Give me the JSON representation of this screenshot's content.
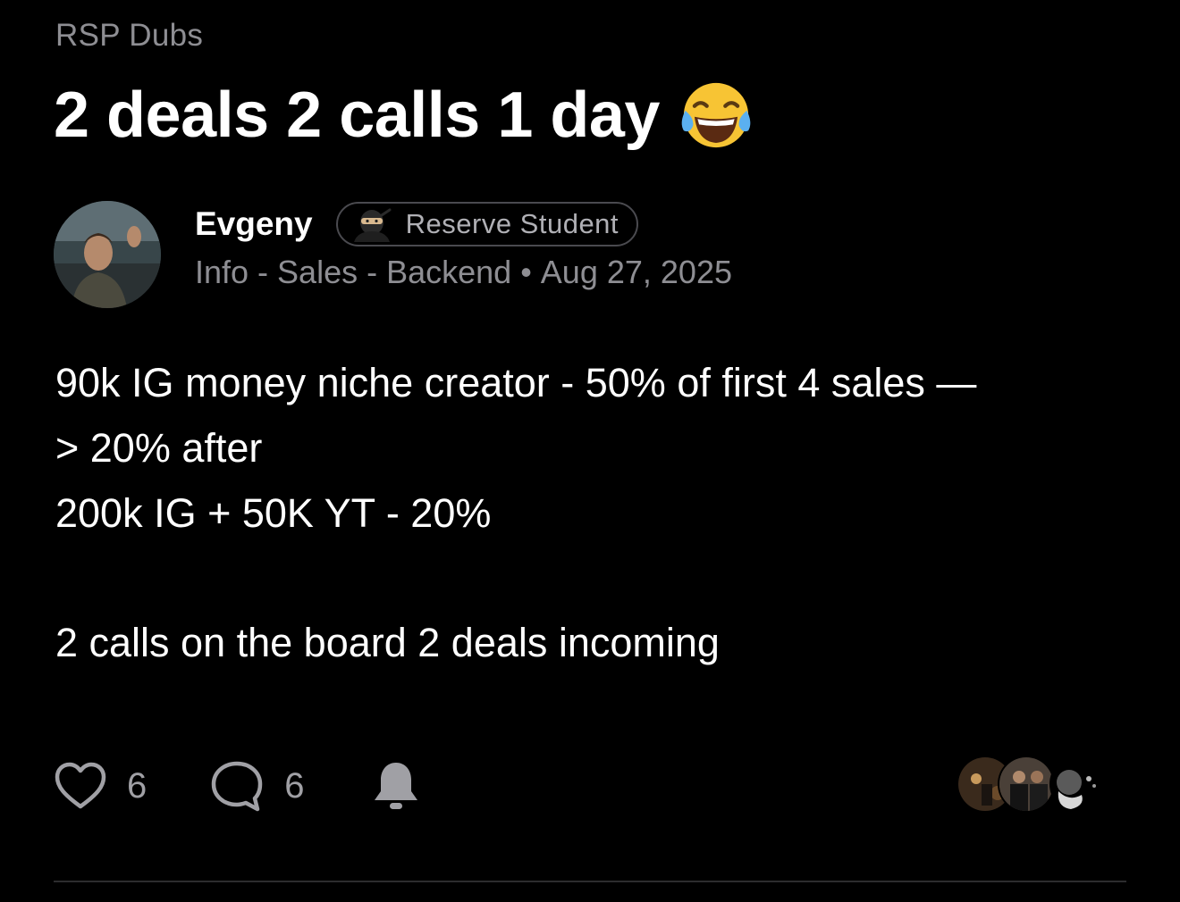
{
  "community": "RSP Dubs",
  "post": {
    "title": "2 deals 2 calls 1 day",
    "title_emoji": "face-with-tears-of-joy",
    "author": {
      "name": "Evgeny",
      "badge": "Reserve Student",
      "badge_icon": "ninja",
      "tags": "Info - Sales - Backend",
      "separator": "•",
      "date": "Aug 27, 2025"
    },
    "body": {
      "line1": "90k IG money niche creator - 50% of first 4 sales —",
      "line2": "> 20% after",
      "line3": "200k IG + 50K YT - 20%",
      "line4": "2 calls on the board 2 deals incoming"
    },
    "likes": "6",
    "comments": "6"
  },
  "colors": {
    "background": "#000000",
    "text_primary": "#ffffff",
    "text_secondary": "#8e8e93",
    "icon": "#a0a0a5",
    "divider": "#2c2c2e"
  }
}
